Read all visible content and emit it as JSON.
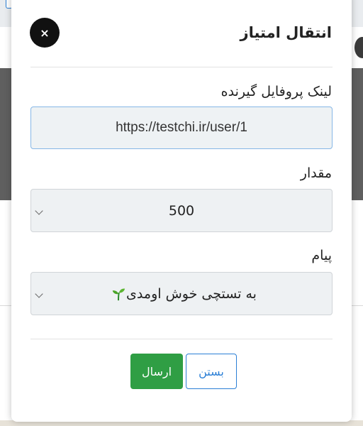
{
  "modal": {
    "title": "انتقال امتیاز",
    "close_label": "×"
  },
  "fields": {
    "profile_link": {
      "label": "لینک پروفایل گیرنده",
      "value": "https://testchi.ir/user/1"
    },
    "amount": {
      "label": "مقدار",
      "value": "500"
    },
    "message": {
      "label": "پیام",
      "value": "به تستچی خوش اومدی",
      "icon": "sprout-icon"
    }
  },
  "buttons": {
    "send": "ارسال",
    "close": "بستن"
  },
  "colors": {
    "send_button": "#2f9e44",
    "close_button_border": "#2b7fd6",
    "link_field_border": "#86b7e6"
  }
}
